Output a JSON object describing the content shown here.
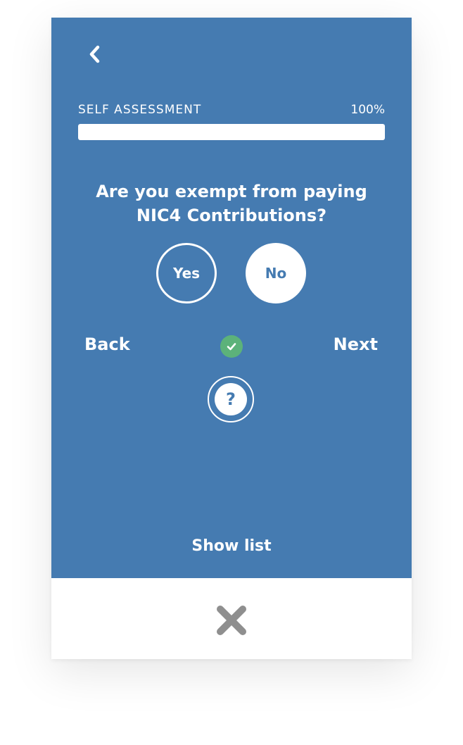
{
  "header": {
    "back_icon": "chevron-left-icon"
  },
  "progress": {
    "label": "SELF ASSESSMENT",
    "percent_text": "100%",
    "fraction": 1.0
  },
  "question": {
    "text": "Are you exempt from paying NIC4 Contributions?"
  },
  "answers": {
    "yes_label": "Yes",
    "no_label": "No",
    "selected": "No"
  },
  "navigation": {
    "back_label": "Back",
    "next_label": "Next",
    "status_icon": "check-circle-icon"
  },
  "help": {
    "icon": "question-mark-icon",
    "glyph": "?"
  },
  "list": {
    "show_list_label": "Show list"
  },
  "footer": {
    "close_icon": "close-x-icon"
  },
  "colors": {
    "primary_blue": "#457bb1",
    "check_green": "#5cb27a",
    "close_gray": "#8f8f8f"
  }
}
